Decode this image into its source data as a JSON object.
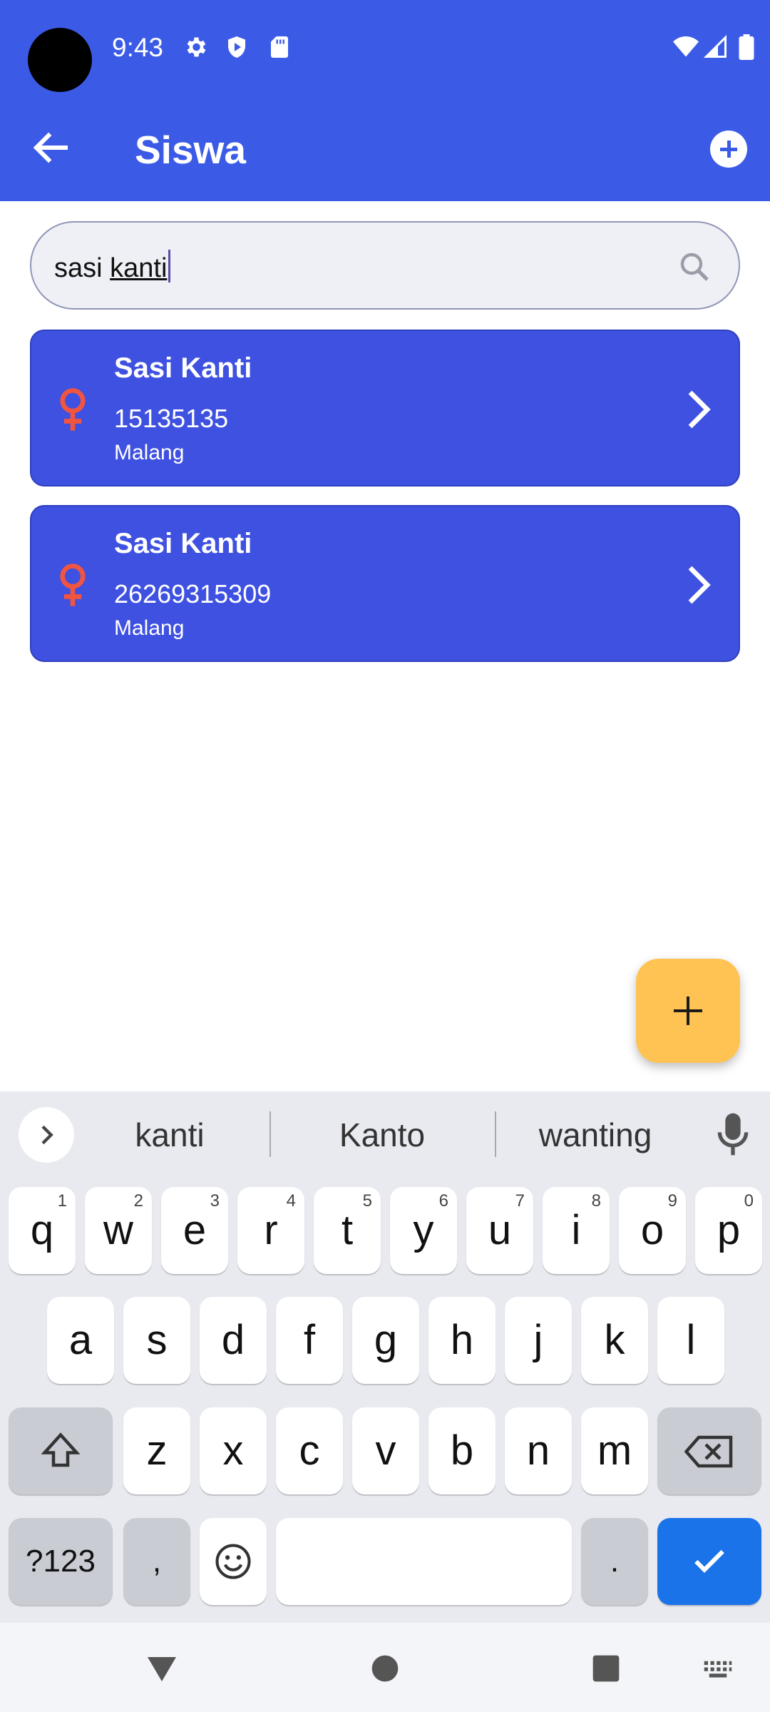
{
  "status_bar": {
    "time": "9:43"
  },
  "app_bar": {
    "title": "Siswa"
  },
  "search": {
    "value_prefix": "sasi ",
    "value_word": "kanti"
  },
  "students": [
    {
      "name": "Sasi Kanti",
      "nis": "15135135",
      "city": "Malang"
    },
    {
      "name": "Sasi Kanti",
      "nis": "26269315309",
      "city": "Malang"
    }
  ],
  "keyboard": {
    "suggestions": [
      "kanti",
      "Kanto",
      "wanting"
    ],
    "row1": [
      "q",
      "w",
      "e",
      "r",
      "t",
      "y",
      "u",
      "i",
      "o",
      "p"
    ],
    "row1_hints": [
      "1",
      "2",
      "3",
      "4",
      "5",
      "6",
      "7",
      "8",
      "9",
      "0"
    ],
    "row2": [
      "a",
      "s",
      "d",
      "f",
      "g",
      "h",
      "j",
      "k",
      "l"
    ],
    "row3": [
      "z",
      "x",
      "c",
      "v",
      "b",
      "n",
      "m"
    ],
    "symbols_label": "?123",
    "comma": ",",
    "period": "."
  },
  "colors": {
    "app_bar": "#3B5BE7",
    "card": "#3F51E0",
    "female_icon": "#F2553F",
    "fab": "#FFC353",
    "enter_key": "#1A73E8"
  }
}
